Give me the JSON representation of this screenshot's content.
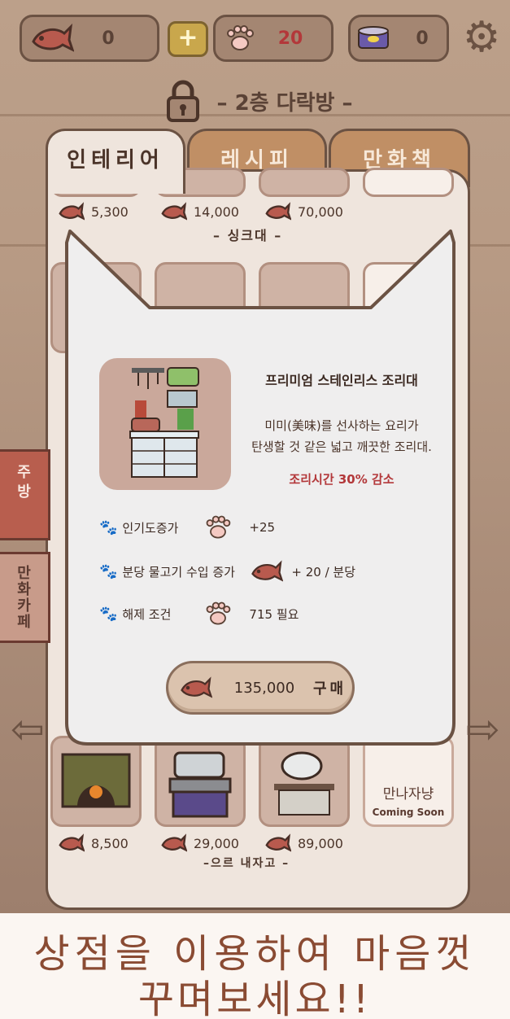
{
  "resources": {
    "fish": "0",
    "popularity": "20",
    "can": "0"
  },
  "floor": {
    "title": "– 2층 다락방 –"
  },
  "tabs": [
    {
      "label": "인테리어"
    },
    {
      "label": "레시피"
    },
    {
      "label": "만화책"
    }
  ],
  "side_tabs": [
    {
      "label": "주방"
    },
    {
      "label": "만화카페"
    }
  ],
  "shop": {
    "top_prices": [
      "5,300",
      "14,000",
      "70,000"
    ],
    "section_top": "– 싱크대 –",
    "bottom_prices": [
      "8,500",
      "29,000",
      "89,000"
    ],
    "section_bottom": "–으르 내자고 –",
    "coming_soon_line1": "만나자냥",
    "coming_soon_line2": "Coming Soon"
  },
  "modal": {
    "name": "프리미엄 스테인리스 조리대",
    "desc_line1": "미미(美味)를 선사하는 요리가",
    "desc_line2": "탄생할 것 같은 넓고 깨끗한 조리대.",
    "effect": "조리시간 30% 감소",
    "stats": [
      {
        "label": "인기도증가",
        "value": "+25"
      },
      {
        "label": "분당 물고기 수입 증가",
        "value": "+ 20 / 분당"
      },
      {
        "label": "해제 조건",
        "value": "715 필요"
      }
    ],
    "buy_price": "135,000",
    "buy_label": "구매"
  },
  "caption": {
    "line1": "상점을 이용하여 마음껏",
    "line2": "꾸며보세요!!"
  },
  "colors": {
    "accent": "#b3383a",
    "frame": "#6b5243",
    "panel": "#efe5dd",
    "caption_text": "#8a4b33"
  },
  "icons": {
    "fish": "fish-icon",
    "paw": "paw-icon",
    "can": "cat-food-can-icon",
    "gear": "gear-icon",
    "lock": "lock-icon"
  }
}
